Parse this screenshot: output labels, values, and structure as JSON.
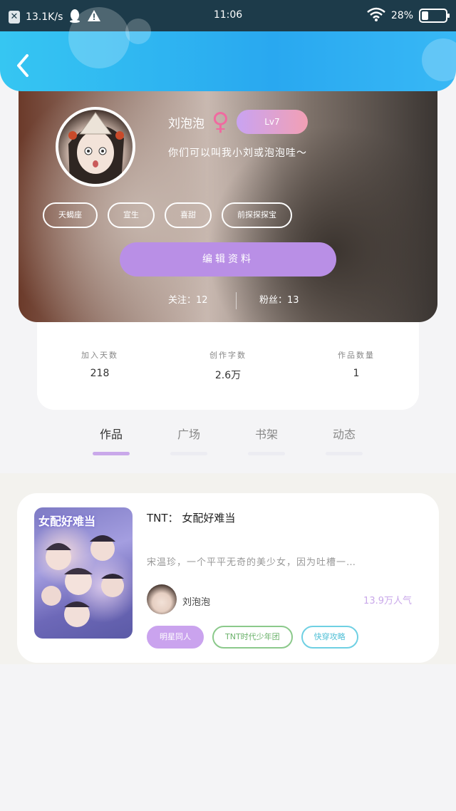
{
  "status_bar": {
    "network_speed": "13.1K/s",
    "time": "11:06",
    "battery_percent": "28%",
    "battery_level": 0.28,
    "icons": [
      "close-box-icon",
      "qq-icon",
      "warning-icon",
      "wifi-icon",
      "battery-icon"
    ]
  },
  "header": {
    "back_icon": "chevron-left-icon",
    "accent": "#2aaaf0"
  },
  "profile": {
    "username": "刘泡泡",
    "gender_symbol": "♀",
    "level": "Lv7",
    "bio": "你们可以叫我小刘或泡泡哇～",
    "tags": [
      "天蝎座",
      "宣生",
      "喜甜",
      "前探探探宝"
    ],
    "edit_button": "编辑资料",
    "following": "关注：12",
    "followers": "粉丝：13"
  },
  "stats": [
    {
      "label": "加入天数",
      "value": "218"
    },
    {
      "label": "创作字数",
      "value": "2.6万"
    },
    {
      "label": "作品数量",
      "value": "1"
    }
  ],
  "tabs": [
    {
      "label": "作品",
      "active": true
    },
    {
      "label": "广场",
      "active": false
    },
    {
      "label": "书架",
      "active": false
    },
    {
      "label": "动态",
      "active": false
    }
  ],
  "work": {
    "cover_text": "女配好难当",
    "title": "TNT： 女配好难当",
    "description": "宋温珍，一个平平无奇的美少女，因为吐槽一…",
    "author": "刘泡泡",
    "popularity": "13.9万人气",
    "tags": [
      "明星同人",
      "TNT时代少年团",
      "快穿攻略"
    ]
  },
  "colors": {
    "level_badge": "#e8a3c9",
    "edit_button": "#b98fe6",
    "tab_active": "#c9a8ea",
    "tag_green": "#8bc98b",
    "tag_cyan": "#6fd0e3"
  }
}
